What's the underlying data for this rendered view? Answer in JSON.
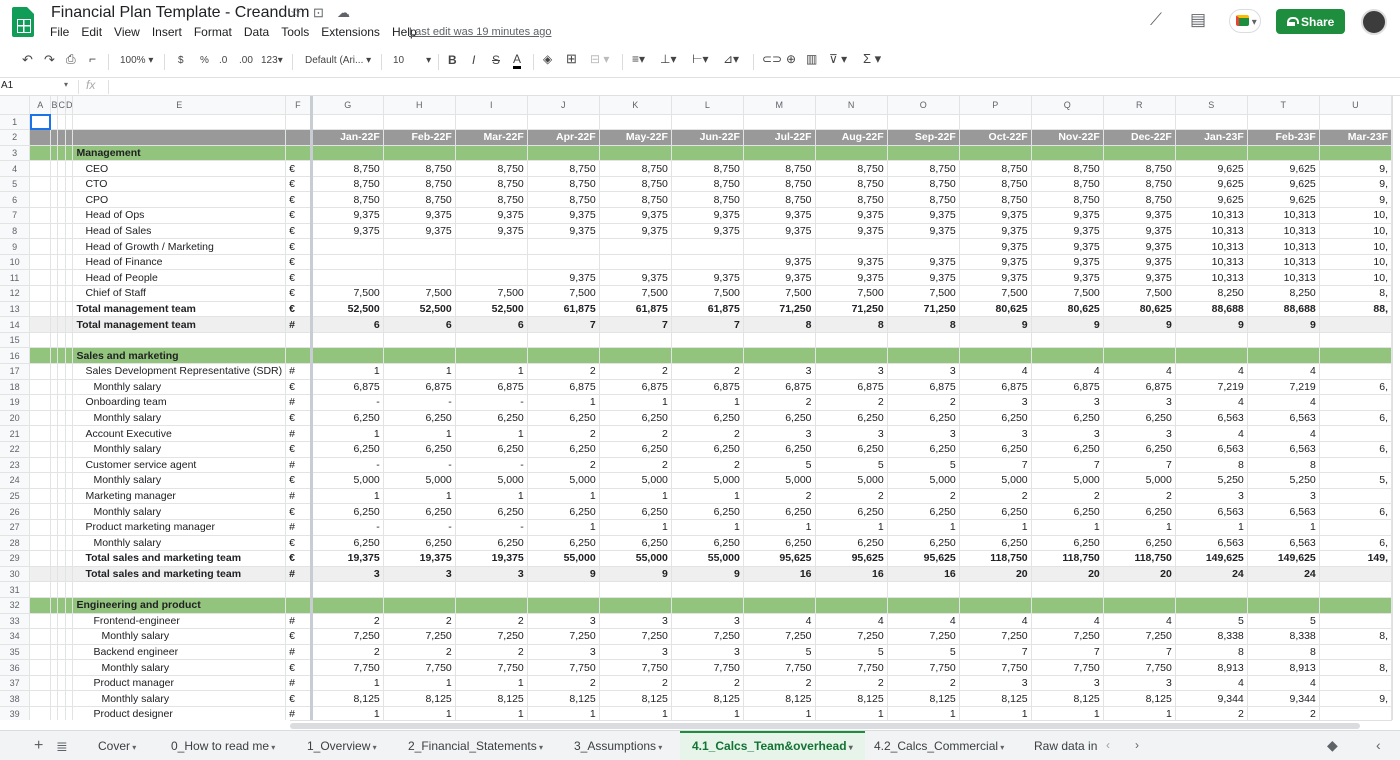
{
  "app": {
    "title": "Financial Plan Template - Creandum",
    "menu": [
      "File",
      "Edit",
      "View",
      "Insert",
      "Format",
      "Data",
      "Tools",
      "Extensions",
      "Help"
    ],
    "last_edit": "Last edit was 19 minutes ago",
    "share_label": "Share"
  },
  "icons": {
    "star": "star-icon",
    "folder": "move-icon",
    "cloud": "cloud-status-icon",
    "trend": "explore-trend-icon",
    "comments": "comments-icon",
    "meet": "meet-icon"
  },
  "toolbar": {
    "zoom": "100%",
    "currency": "$",
    "percent": "%",
    "dec_less": ".0",
    "dec_more": ".00",
    "more_formats": "123",
    "font": "Default (Ari...",
    "font_size": "10"
  },
  "cell_ref": "A1",
  "fx": "fx",
  "columns": [
    "",
    "A",
    "B",
    "C",
    "D",
    "E",
    "F",
    "G",
    "H",
    "I",
    "J",
    "K",
    "L",
    "M",
    "N",
    "O",
    "P",
    "Q",
    "R",
    "S",
    "T",
    "U"
  ],
  "month_header": [
    "Jan-22F",
    "Feb-22F",
    "Mar-22F",
    "Apr-22F",
    "May-22F",
    "Jun-22F",
    "Jul-22F",
    "Aug-22F",
    "Sep-22F",
    "Oct-22F",
    "Nov-22F",
    "Dec-22F",
    "Jan-23F",
    "Feb-23F",
    "Mar-23F"
  ],
  "rows": [
    {
      "n": "1",
      "t": "blank",
      "label": "",
      "indent": 0,
      "unit": "",
      "v": []
    },
    {
      "n": "2",
      "t": "mhdr",
      "label": "",
      "indent": 0,
      "unit": "",
      "v": []
    },
    {
      "n": "3",
      "t": "sect",
      "label": "Management",
      "indent": 0,
      "unit": "",
      "v": []
    },
    {
      "n": "4",
      "t": "row",
      "label": "CEO",
      "indent": 1,
      "unit": "€",
      "v": [
        "8,750",
        "8,750",
        "8,750",
        "8,750",
        "8,750",
        "8,750",
        "8,750",
        "8,750",
        "8,750",
        "8,750",
        "8,750",
        "8,750",
        "9,625",
        "9,625",
        "9,"
      ]
    },
    {
      "n": "5",
      "t": "row",
      "label": "CTO",
      "indent": 1,
      "unit": "€",
      "v": [
        "8,750",
        "8,750",
        "8,750",
        "8,750",
        "8,750",
        "8,750",
        "8,750",
        "8,750",
        "8,750",
        "8,750",
        "8,750",
        "8,750",
        "9,625",
        "9,625",
        "9,"
      ]
    },
    {
      "n": "6",
      "t": "row",
      "label": "CPO",
      "indent": 1,
      "unit": "€",
      "v": [
        "8,750",
        "8,750",
        "8,750",
        "8,750",
        "8,750",
        "8,750",
        "8,750",
        "8,750",
        "8,750",
        "8,750",
        "8,750",
        "8,750",
        "9,625",
        "9,625",
        "9,"
      ]
    },
    {
      "n": "7",
      "t": "row",
      "label": "Head of Ops",
      "indent": 1,
      "unit": "€",
      "v": [
        "9,375",
        "9,375",
        "9,375",
        "9,375",
        "9,375",
        "9,375",
        "9,375",
        "9,375",
        "9,375",
        "9,375",
        "9,375",
        "9,375",
        "10,313",
        "10,313",
        "10,"
      ]
    },
    {
      "n": "8",
      "t": "row",
      "label": "Head of Sales",
      "indent": 1,
      "unit": "€",
      "v": [
        "9,375",
        "9,375",
        "9,375",
        "9,375",
        "9,375",
        "9,375",
        "9,375",
        "9,375",
        "9,375",
        "9,375",
        "9,375",
        "9,375",
        "10,313",
        "10,313",
        "10,"
      ]
    },
    {
      "n": "9",
      "t": "row",
      "label": "Head of Growth / Marketing",
      "indent": 1,
      "unit": "€",
      "v": [
        "",
        "",
        "",
        "",
        "",
        "",
        "",
        "",
        "",
        "9,375",
        "9,375",
        "9,375",
        "10,313",
        "10,313",
        "10,"
      ]
    },
    {
      "n": "10",
      "t": "row",
      "label": "Head of Finance",
      "indent": 1,
      "unit": "€",
      "v": [
        "",
        "",
        "",
        "",
        "",
        "",
        "9,375",
        "9,375",
        "9,375",
        "9,375",
        "9,375",
        "9,375",
        "10,313",
        "10,313",
        "10,"
      ]
    },
    {
      "n": "11",
      "t": "row",
      "label": "Head of People",
      "indent": 1,
      "unit": "€",
      "v": [
        "",
        "",
        "",
        "9,375",
        "9,375",
        "9,375",
        "9,375",
        "9,375",
        "9,375",
        "9,375",
        "9,375",
        "9,375",
        "10,313",
        "10,313",
        "10,"
      ]
    },
    {
      "n": "12",
      "t": "row",
      "label": "Chief of Staff",
      "indent": 1,
      "unit": "€",
      "v": [
        "7,500",
        "7,500",
        "7,500",
        "7,500",
        "7,500",
        "7,500",
        "7,500",
        "7,500",
        "7,500",
        "7,500",
        "7,500",
        "7,500",
        "8,250",
        "8,250",
        "8,"
      ]
    },
    {
      "n": "13",
      "t": "tot",
      "label": "Total management team",
      "indent": 0,
      "unit": "€",
      "v": [
        "52,500",
        "52,500",
        "52,500",
        "61,875",
        "61,875",
        "61,875",
        "71,250",
        "71,250",
        "71,250",
        "80,625",
        "80,625",
        "80,625",
        "88,688",
        "88,688",
        "88,"
      ]
    },
    {
      "n": "14",
      "t": "tot2",
      "label": "Total management team",
      "indent": 0,
      "unit": "#",
      "v": [
        "6",
        "6",
        "6",
        "7",
        "7",
        "7",
        "8",
        "8",
        "8",
        "9",
        "9",
        "9",
        "9",
        "9",
        ""
      ]
    },
    {
      "n": "15",
      "t": "blank",
      "label": "",
      "indent": 0,
      "unit": "",
      "v": []
    },
    {
      "n": "16",
      "t": "sect",
      "label": "Sales and marketing",
      "indent": 0,
      "unit": "",
      "v": []
    },
    {
      "n": "17",
      "t": "row",
      "label": "Sales Development Representative (SDR)",
      "indent": 1,
      "unit": "#",
      "v": [
        "1",
        "1",
        "1",
        "2",
        "2",
        "2",
        "3",
        "3",
        "3",
        "4",
        "4",
        "4",
        "4",
        "4",
        ""
      ]
    },
    {
      "n": "18",
      "t": "row",
      "label": "Monthly salary",
      "indent": 2,
      "unit": "€",
      "v": [
        "6,875",
        "6,875",
        "6,875",
        "6,875",
        "6,875",
        "6,875",
        "6,875",
        "6,875",
        "6,875",
        "6,875",
        "6,875",
        "6,875",
        "7,219",
        "7,219",
        "6,"
      ]
    },
    {
      "n": "19",
      "t": "row",
      "label": "Onboarding team",
      "indent": 1,
      "unit": "#",
      "v": [
        "-",
        "-",
        "-",
        "1",
        "1",
        "1",
        "2",
        "2",
        "2",
        "3",
        "3",
        "3",
        "4",
        "4",
        ""
      ]
    },
    {
      "n": "20",
      "t": "row",
      "label": "Monthly salary",
      "indent": 2,
      "unit": "€",
      "v": [
        "6,250",
        "6,250",
        "6,250",
        "6,250",
        "6,250",
        "6,250",
        "6,250",
        "6,250",
        "6,250",
        "6,250",
        "6,250",
        "6,250",
        "6,563",
        "6,563",
        "6,"
      ]
    },
    {
      "n": "21",
      "t": "row",
      "label": "Account Executive",
      "indent": 1,
      "unit": "#",
      "v": [
        "1",
        "1",
        "1",
        "2",
        "2",
        "2",
        "3",
        "3",
        "3",
        "3",
        "3",
        "3",
        "4",
        "4",
        ""
      ]
    },
    {
      "n": "22",
      "t": "row",
      "label": "Monthly salary",
      "indent": 2,
      "unit": "€",
      "v": [
        "6,250",
        "6,250",
        "6,250",
        "6,250",
        "6,250",
        "6,250",
        "6,250",
        "6,250",
        "6,250",
        "6,250",
        "6,250",
        "6,250",
        "6,563",
        "6,563",
        "6,"
      ]
    },
    {
      "n": "23",
      "t": "row",
      "label": "Customer service agent",
      "indent": 1,
      "unit": "#",
      "v": [
        "-",
        "-",
        "-",
        "2",
        "2",
        "2",
        "5",
        "5",
        "5",
        "7",
        "7",
        "7",
        "8",
        "8",
        ""
      ]
    },
    {
      "n": "24",
      "t": "row",
      "label": "Monthly salary",
      "indent": 2,
      "unit": "€",
      "v": [
        "5,000",
        "5,000",
        "5,000",
        "5,000",
        "5,000",
        "5,000",
        "5,000",
        "5,000",
        "5,000",
        "5,000",
        "5,000",
        "5,000",
        "5,250",
        "5,250",
        "5,"
      ]
    },
    {
      "n": "25",
      "t": "row",
      "label": "Marketing manager",
      "indent": 1,
      "unit": "#",
      "v": [
        "1",
        "1",
        "1",
        "1",
        "1",
        "1",
        "2",
        "2",
        "2",
        "2",
        "2",
        "2",
        "3",
        "3",
        ""
      ]
    },
    {
      "n": "26",
      "t": "row",
      "label": "Monthly salary",
      "indent": 2,
      "unit": "€",
      "v": [
        "6,250",
        "6,250",
        "6,250",
        "6,250",
        "6,250",
        "6,250",
        "6,250",
        "6,250",
        "6,250",
        "6,250",
        "6,250",
        "6,250",
        "6,563",
        "6,563",
        "6,"
      ]
    },
    {
      "n": "27",
      "t": "row",
      "label": "Product marketing manager",
      "indent": 1,
      "unit": "#",
      "v": [
        "-",
        "-",
        "-",
        "1",
        "1",
        "1",
        "1",
        "1",
        "1",
        "1",
        "1",
        "1",
        "1",
        "1",
        ""
      ]
    },
    {
      "n": "28",
      "t": "row",
      "label": "Monthly salary",
      "indent": 2,
      "unit": "€",
      "v": [
        "6,250",
        "6,250",
        "6,250",
        "6,250",
        "6,250",
        "6,250",
        "6,250",
        "6,250",
        "6,250",
        "6,250",
        "6,250",
        "6,250",
        "6,563",
        "6,563",
        "6,"
      ]
    },
    {
      "n": "29",
      "t": "tot",
      "label": "Total sales and marketing team",
      "indent": 1,
      "unit": "€",
      "v": [
        "19,375",
        "19,375",
        "19,375",
        "55,000",
        "55,000",
        "55,000",
        "95,625",
        "95,625",
        "95,625",
        "118,750",
        "118,750",
        "118,750",
        "149,625",
        "149,625",
        "149,"
      ]
    },
    {
      "n": "30",
      "t": "tot2",
      "label": "Total sales and marketing team",
      "indent": 1,
      "unit": "#",
      "v": [
        "3",
        "3",
        "3",
        "9",
        "9",
        "9",
        "16",
        "16",
        "16",
        "20",
        "20",
        "20",
        "24",
        "24",
        ""
      ]
    },
    {
      "n": "31",
      "t": "blank",
      "label": "",
      "indent": 0,
      "unit": "",
      "v": []
    },
    {
      "n": "32",
      "t": "sect",
      "label": "Engineering and product",
      "indent": 0,
      "unit": "",
      "v": []
    },
    {
      "n": "33",
      "t": "row",
      "label": "Frontend-engineer",
      "indent": 2,
      "unit": "#",
      "v": [
        "2",
        "2",
        "2",
        "3",
        "3",
        "3",
        "4",
        "4",
        "4",
        "4",
        "4",
        "4",
        "5",
        "5",
        ""
      ]
    },
    {
      "n": "34",
      "t": "row",
      "label": "Monthly salary",
      "indent": 3,
      "unit": "€",
      "v": [
        "7,250",
        "7,250",
        "7,250",
        "7,250",
        "7,250",
        "7,250",
        "7,250",
        "7,250",
        "7,250",
        "7,250",
        "7,250",
        "7,250",
        "8,338",
        "8,338",
        "8,"
      ]
    },
    {
      "n": "35",
      "t": "row",
      "label": "Backend engineer",
      "indent": 2,
      "unit": "#",
      "v": [
        "2",
        "2",
        "2",
        "3",
        "3",
        "3",
        "5",
        "5",
        "5",
        "7",
        "7",
        "7",
        "8",
        "8",
        ""
      ]
    },
    {
      "n": "36",
      "t": "row",
      "label": "Monthly salary",
      "indent": 3,
      "unit": "€",
      "v": [
        "7,750",
        "7,750",
        "7,750",
        "7,750",
        "7,750",
        "7,750",
        "7,750",
        "7,750",
        "7,750",
        "7,750",
        "7,750",
        "7,750",
        "8,913",
        "8,913",
        "8,"
      ]
    },
    {
      "n": "37",
      "t": "row",
      "label": "Product manager",
      "indent": 2,
      "unit": "#",
      "v": [
        "1",
        "1",
        "1",
        "2",
        "2",
        "2",
        "2",
        "2",
        "2",
        "3",
        "3",
        "3",
        "4",
        "4",
        ""
      ]
    },
    {
      "n": "38",
      "t": "row",
      "label": "Monthly salary",
      "indent": 3,
      "unit": "€",
      "v": [
        "8,125",
        "8,125",
        "8,125",
        "8,125",
        "8,125",
        "8,125",
        "8,125",
        "8,125",
        "8,125",
        "8,125",
        "8,125",
        "8,125",
        "9,344",
        "9,344",
        "9,"
      ]
    },
    {
      "n": "39",
      "t": "row",
      "label": "Product designer",
      "indent": 2,
      "unit": "#",
      "v": [
        "1",
        "1",
        "1",
        "1",
        "1",
        "1",
        "1",
        "1",
        "1",
        "1",
        "1",
        "1",
        "2",
        "2",
        ""
      ]
    }
  ],
  "sheets": [
    {
      "label": "Cover",
      "active": false
    },
    {
      "label": "0_How to read me",
      "active": false
    },
    {
      "label": "1_Overview",
      "active": false
    },
    {
      "label": "2_Financial_Statements",
      "active": false
    },
    {
      "label": "3_Assumptions",
      "active": false
    },
    {
      "label": "4.1_Calcs_Team&overhead",
      "active": true
    },
    {
      "label": "4.2_Calcs_Commercial",
      "active": false
    },
    {
      "label": "Raw data in",
      "active": false
    }
  ],
  "colors": {
    "brand_green": "#0f9d58",
    "share_green": "#1e8e3e",
    "section_green": "#93c47d",
    "header_gray": "#999999"
  }
}
